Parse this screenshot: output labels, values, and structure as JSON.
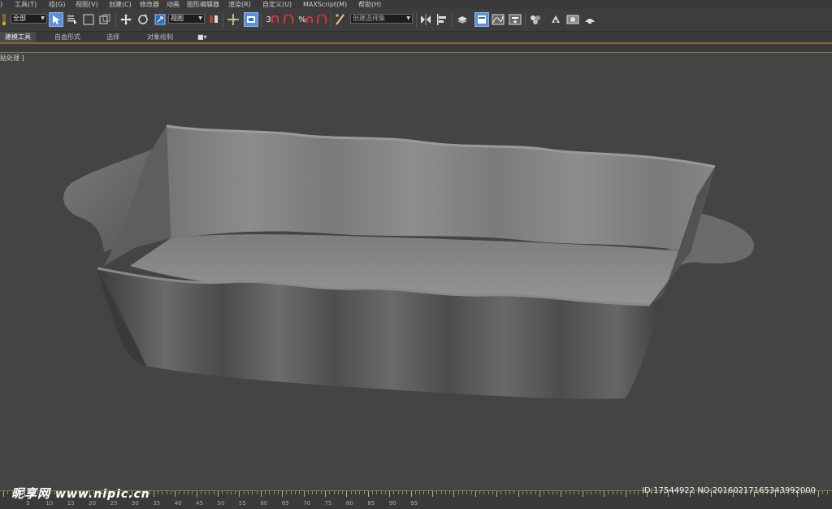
{
  "menu": [
    "工具(T)",
    "组(G)",
    "视图(V)",
    "创建(C)",
    "修改器",
    "动画",
    "图形编辑器",
    "渲染(R)",
    "自定义(U)",
    "MAXScript(M)",
    "帮助(H)"
  ],
  "menu_prefix": ")",
  "toolbar": {
    "filter_value": "全部",
    "coord_value": "视图",
    "selection_set_placeholder": "创建选择集",
    "snap_labels": [
      "3",
      "%"
    ]
  },
  "ribbon": {
    "tabs": [
      "建模工具",
      "自由形式",
      "选择",
      "对象绘制"
    ],
    "active_index": 0
  },
  "viewport": {
    "label": "贴处理 ]"
  },
  "ruler": {
    "labels": [
      "5",
      "10",
      "15",
      "20",
      "25",
      "30",
      "35",
      "40",
      "45",
      "50",
      "55",
      "60",
      "65",
      "70",
      "75",
      "80",
      "85",
      "90",
      "95"
    ]
  },
  "watermark": {
    "site_name": "昵享网",
    "site_url": "www.nipic.cn",
    "image_id": "ID:17544922 NO:20160217165343992000"
  },
  "colors": {
    "background": "#444444",
    "accent_blue": "#5b8fd8",
    "frame_gold": "#8a7a38"
  }
}
